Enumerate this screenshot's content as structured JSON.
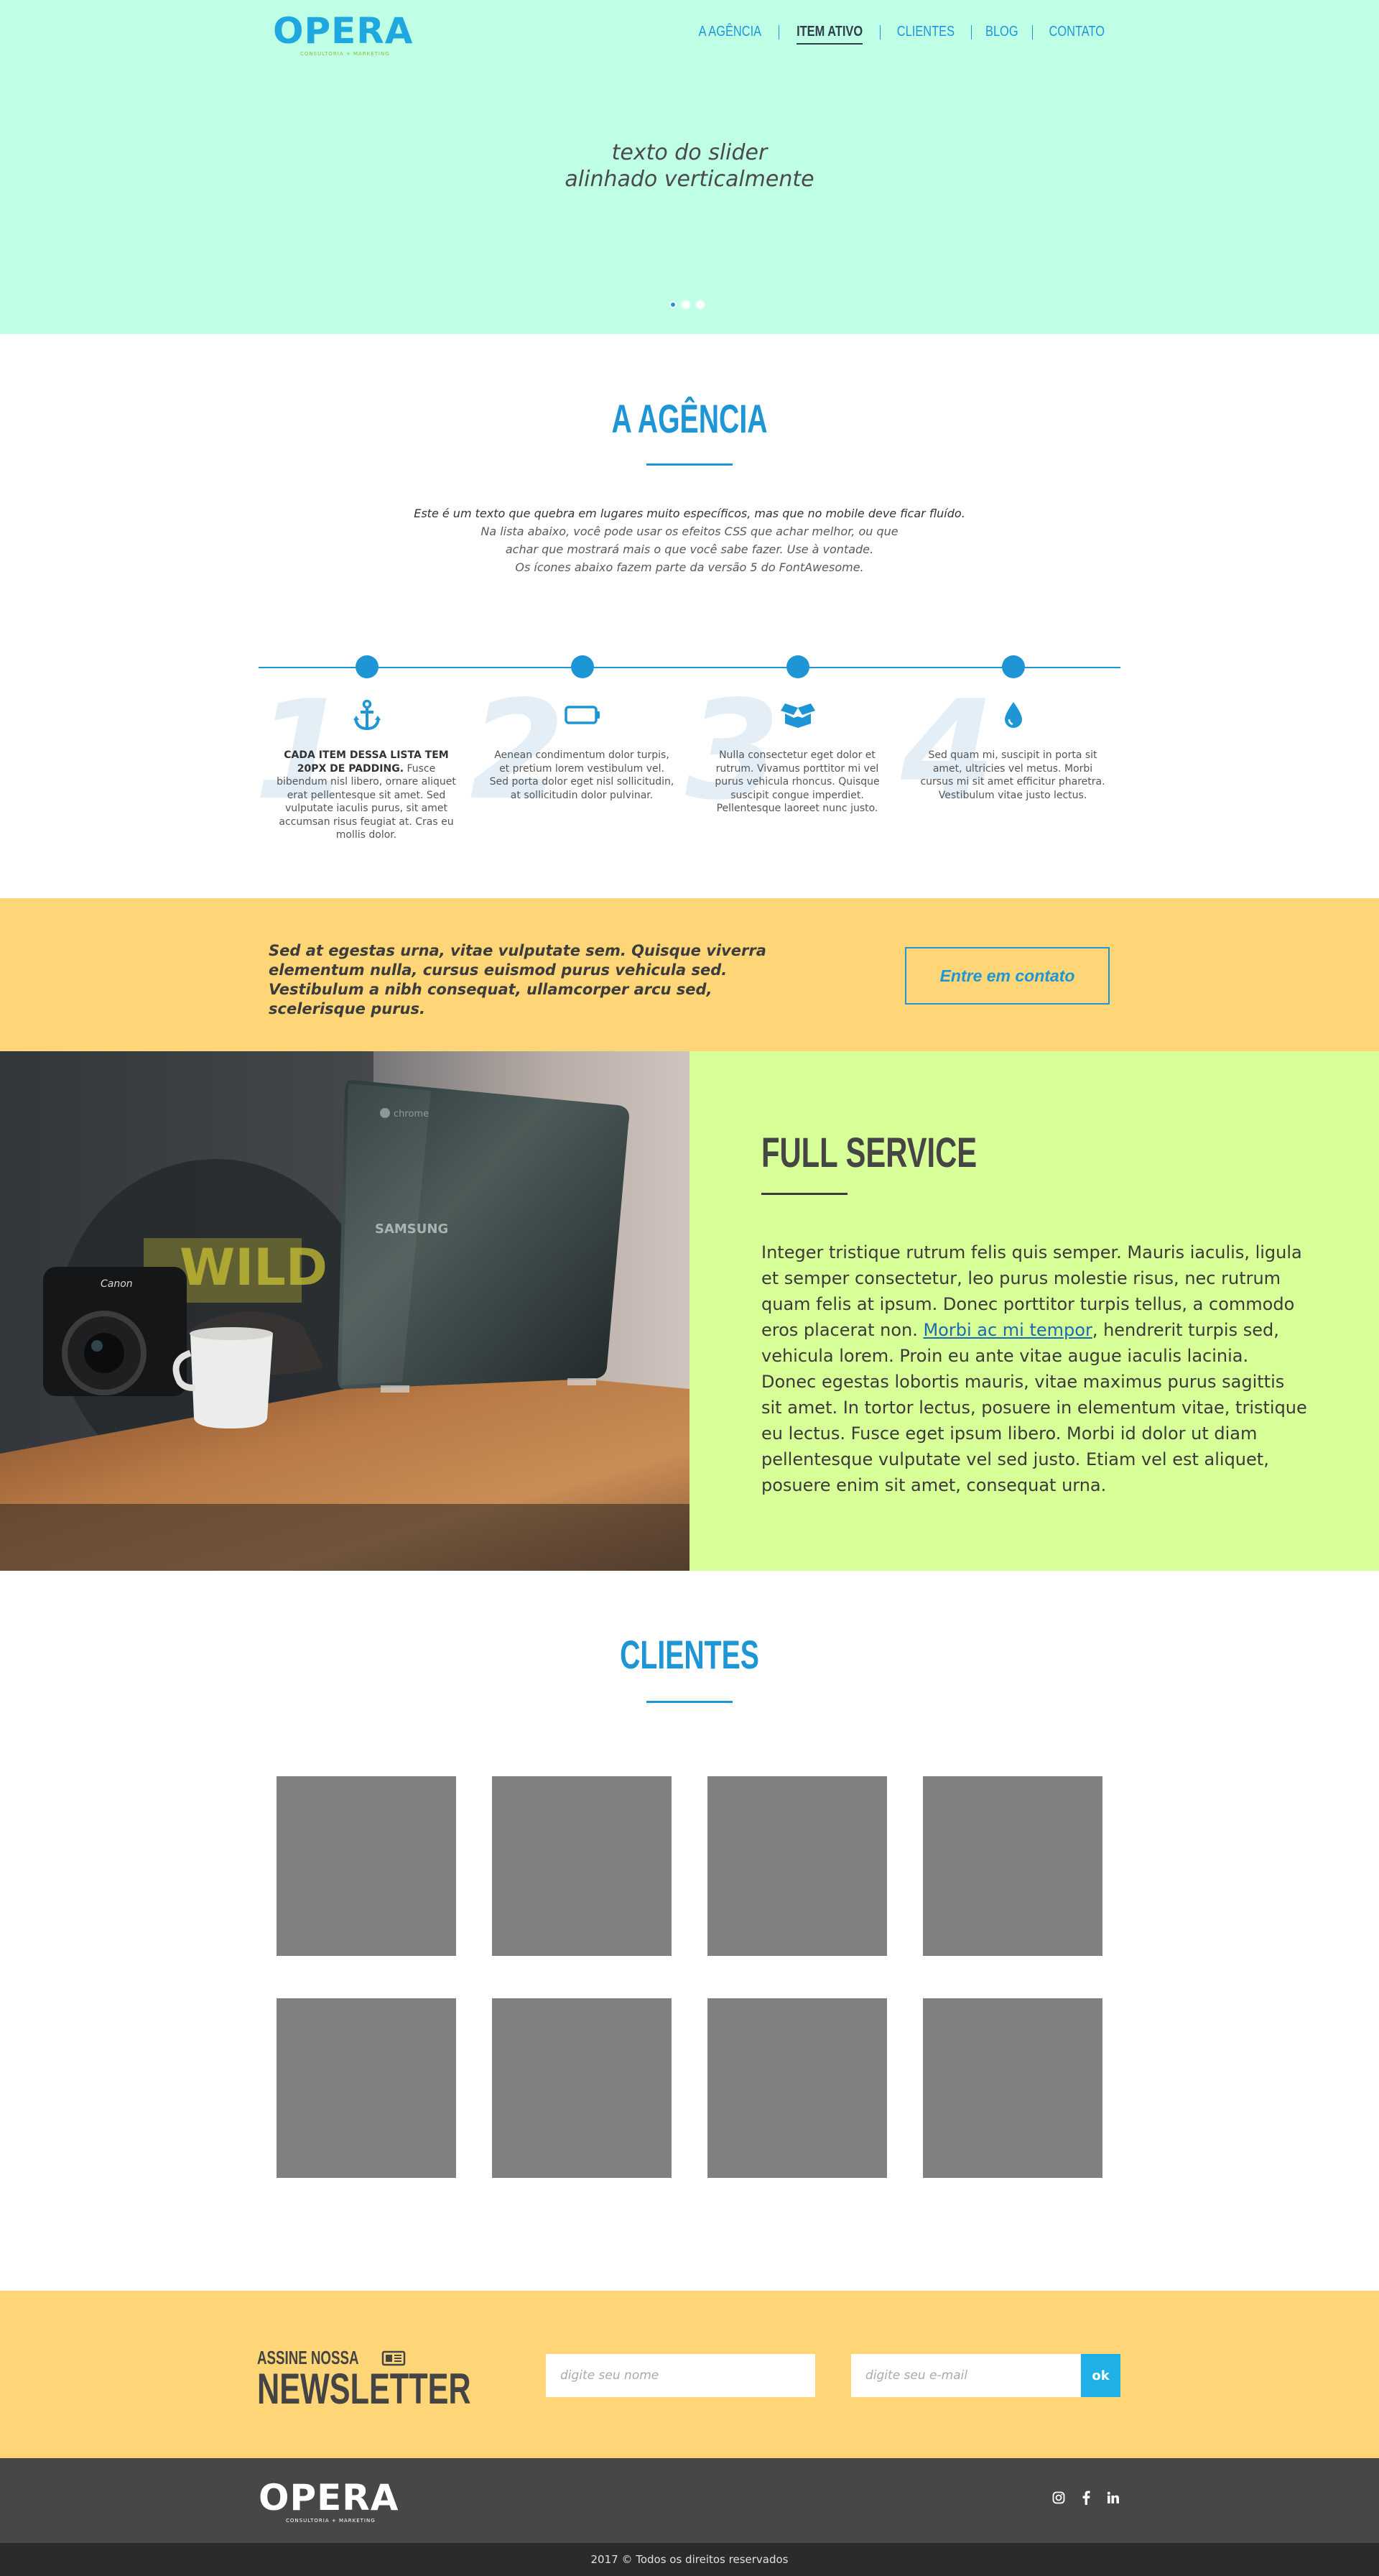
{
  "brand": {
    "logo_text": "OPERA",
    "logo_tagline": "Consultoria + Marketing"
  },
  "nav": {
    "items": [
      {
        "label": "A AGÊNCIA",
        "active": false
      },
      {
        "label": "ITEM ATIVO",
        "active": true
      },
      {
        "label": "CLIENTES",
        "active": false
      },
      {
        "label": "BLOG",
        "active": false
      },
      {
        "label": "CONTATO",
        "active": false
      }
    ]
  },
  "hero": {
    "line1": "texto do slider",
    "line2": "alinhado verticalmente",
    "slides_count": 3,
    "active_slide": 1
  },
  "agencia": {
    "title": "A AGÊNCIA",
    "text_lines": [
      "Este é um texto que quebra em lugares muito específicos, mas que no mobile  deve ficar fluído.",
      "Na lista abaixo, você pode usar os efeitos CSS que achar melhor, ou que",
      "achar que mostrará mais o que você sabe fazer. Use à vontade.",
      "Os ícones abaixo fazem parte da versão 5 do FontAwesome."
    ],
    "steps": [
      {
        "number": "1",
        "icon": "anchor-icon",
        "lead": "CADA ITEM DESSA LISTA TEM 20PX DE PADDING.",
        "text": " Fusce bibendum nisl libero, ornare aliquet erat pellentesque sit amet. Sed vulputate iaculis purus, sit amet accumsan risus feugiat at. Cras eu mollis dolor."
      },
      {
        "number": "2",
        "icon": "battery-icon",
        "lead": "",
        "text": "Aenean condimentum dolor turpis, et pretium lorem vestibulum vel. Sed porta dolor eget nisl sollicitudin, at sollicitudin dolor pulvinar."
      },
      {
        "number": "3",
        "icon": "box-open-icon",
        "lead": "",
        "text": "Nulla consectetur eget dolor et rutrum. Vivamus porttitor mi vel purus vehicula rhoncus. Quisque suscipit congue imperdiet. Pellentesque laoreet nunc justo."
      },
      {
        "number": "4",
        "icon": "tint-icon",
        "lead": "",
        "text": "Sed quam mi, suscipit in porta sit amet, ultricies vel metus. Morbi cursus mi sit amet efficitur pharetra. Vestibulum vitae justo lectus."
      }
    ]
  },
  "cta": {
    "text": "Sed at egestas urna, vitae vulputate sem. Quisque viverra elementum nulla, cursus euismod purus vehicula sed. Vestibulum a nibh consequat, ullamcorper arcu sed, scelerisque purus.",
    "button_label": "Entre em contato"
  },
  "service": {
    "title": "FULL SERVICE",
    "text_before": "Integer tristique rutrum felis quis semper. Mauris iaculis, ligula et semper consectetur, leo purus molestie risus, nec rutrum quam felis at ipsum. Donec porttitor turpis tellus, a commodo eros placerat non. ",
    "link_text": "Morbi ac mi tempor",
    "text_after": ", hendrerit turpis sed, vehicula lorem. Proin eu ante vitae augue iaculis lacinia. Donec egestas lobortis mauris, vitae maximus purus sagittis sit amet. In tortor lectus, posuere in elementum vitae, tristique eu lectus. Fusce eget ipsum libero. Morbi id dolor ut diam pellentesque vulputate vel sed justo. Etiam vel est aliquet, posuere enim sit amet, consequat urna.",
    "photo_text_laptop": "SAMSUNG",
    "photo_text_chrome": "chrome",
    "photo_text_camera": "Canon",
    "photo_text_shirt": "WILD"
  },
  "clientes": {
    "title": "CLIENTES",
    "logos_count": 8
  },
  "newsletter": {
    "small": "ASSINE NOSSA",
    "big": "NEWSLETTER",
    "name_placeholder": "digite seu nome",
    "email_placeholder": "digite seu e-mail",
    "submit_label": "ok"
  },
  "footer": {
    "social": [
      "instagram-icon",
      "facebook-icon",
      "linkedin-icon"
    ],
    "copyright": "2017 © Todos os direitos reservados"
  },
  "colors": {
    "accent": "#1e96d6",
    "hero_bg": "#bfffe6",
    "cta_bg": "#fed677",
    "service_bg": "#d7fe97",
    "footer_bg": "#474747"
  }
}
